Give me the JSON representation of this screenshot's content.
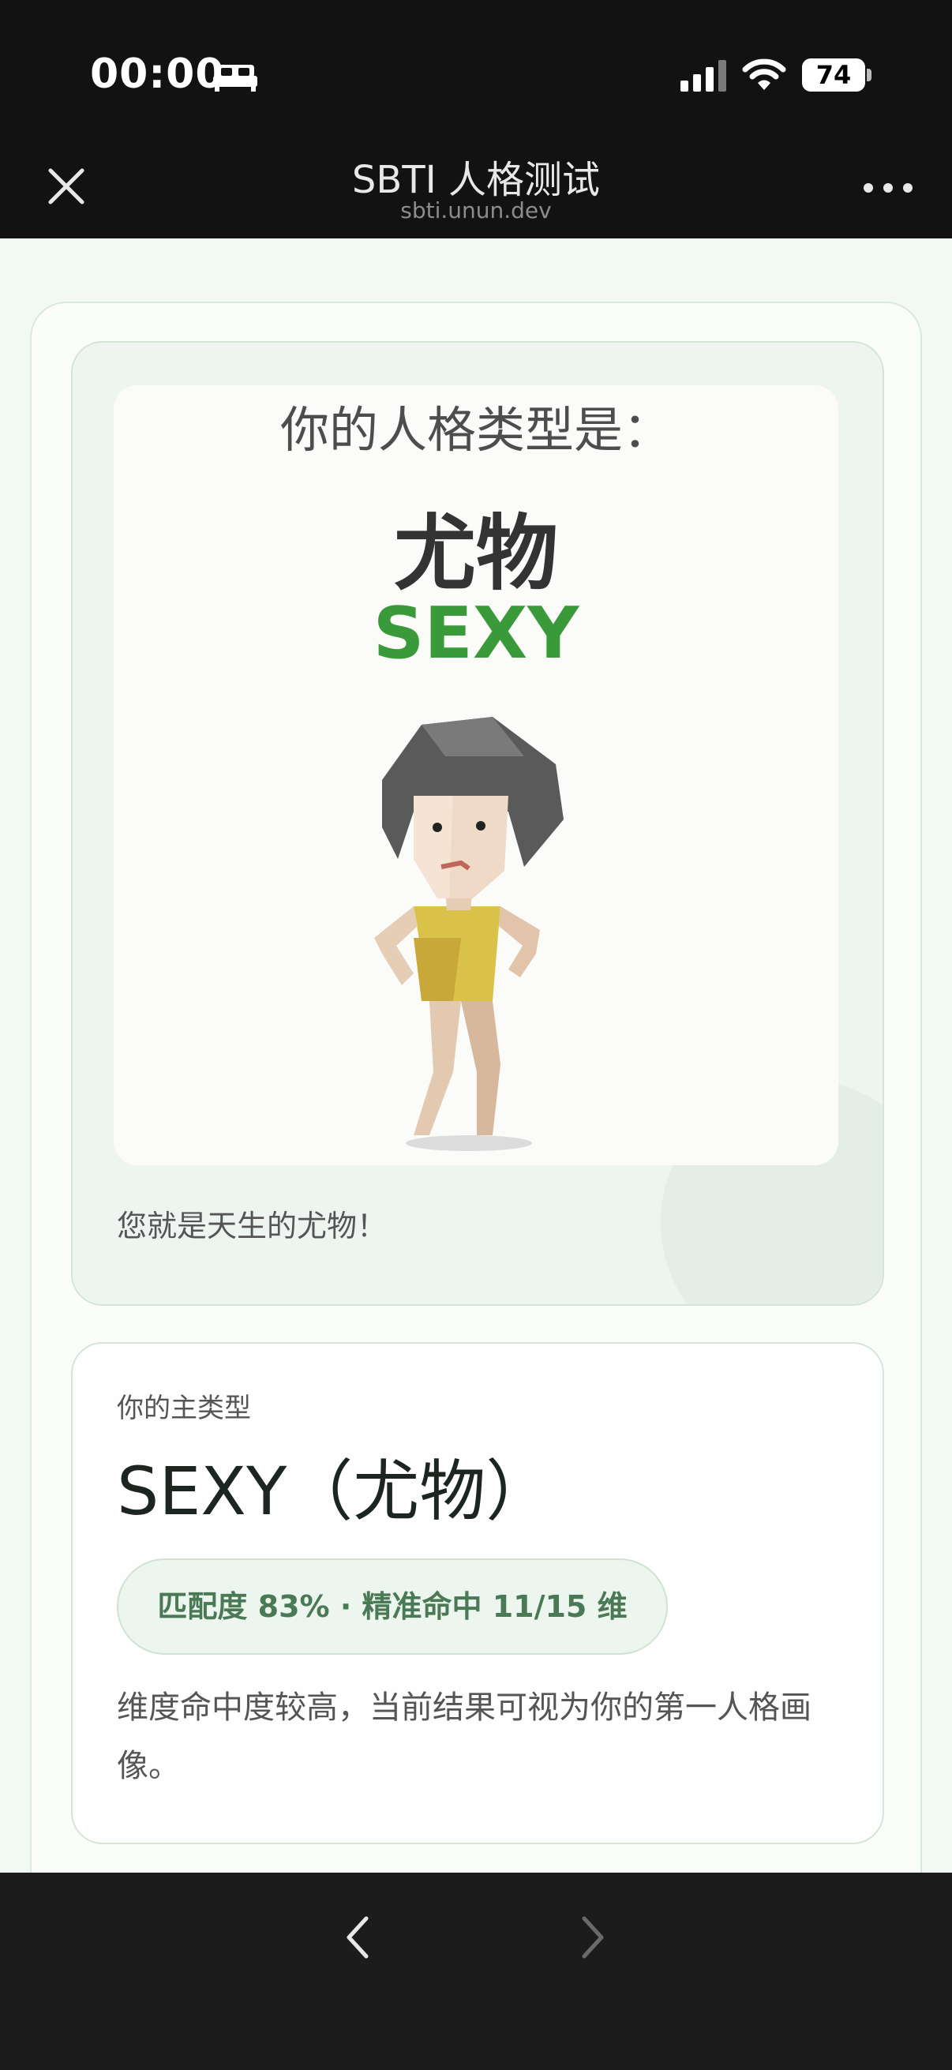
{
  "status_bar": {
    "time": "00:00",
    "battery": "74"
  },
  "header": {
    "title": "SBTI 人格测试",
    "subtitle": "sbti.unun.dev"
  },
  "result_image": {
    "heading": "你的人格类型是：",
    "type_cn": "尤物",
    "type_en": "SEXY",
    "caption": "您就是天生的尤物！"
  },
  "main_type": {
    "label": "你的主类型",
    "title": "SEXY（尤物）",
    "match": "匹配度 83% · 精准命中 11/15 维",
    "match_percent": 83,
    "hits": 11,
    "total_dims": 15,
    "description": "维度命中度较高，当前结果可视为你的第一人格画像。"
  },
  "colors": {
    "accent_green": "#3a9a3a",
    "pill_text": "#4a7a55",
    "background": "#f2f8f3"
  },
  "icons": [
    "bed-icon",
    "signal-icon",
    "wifi-icon",
    "close-icon",
    "more-icon",
    "chevron-left-icon",
    "chevron-right-icon"
  ]
}
